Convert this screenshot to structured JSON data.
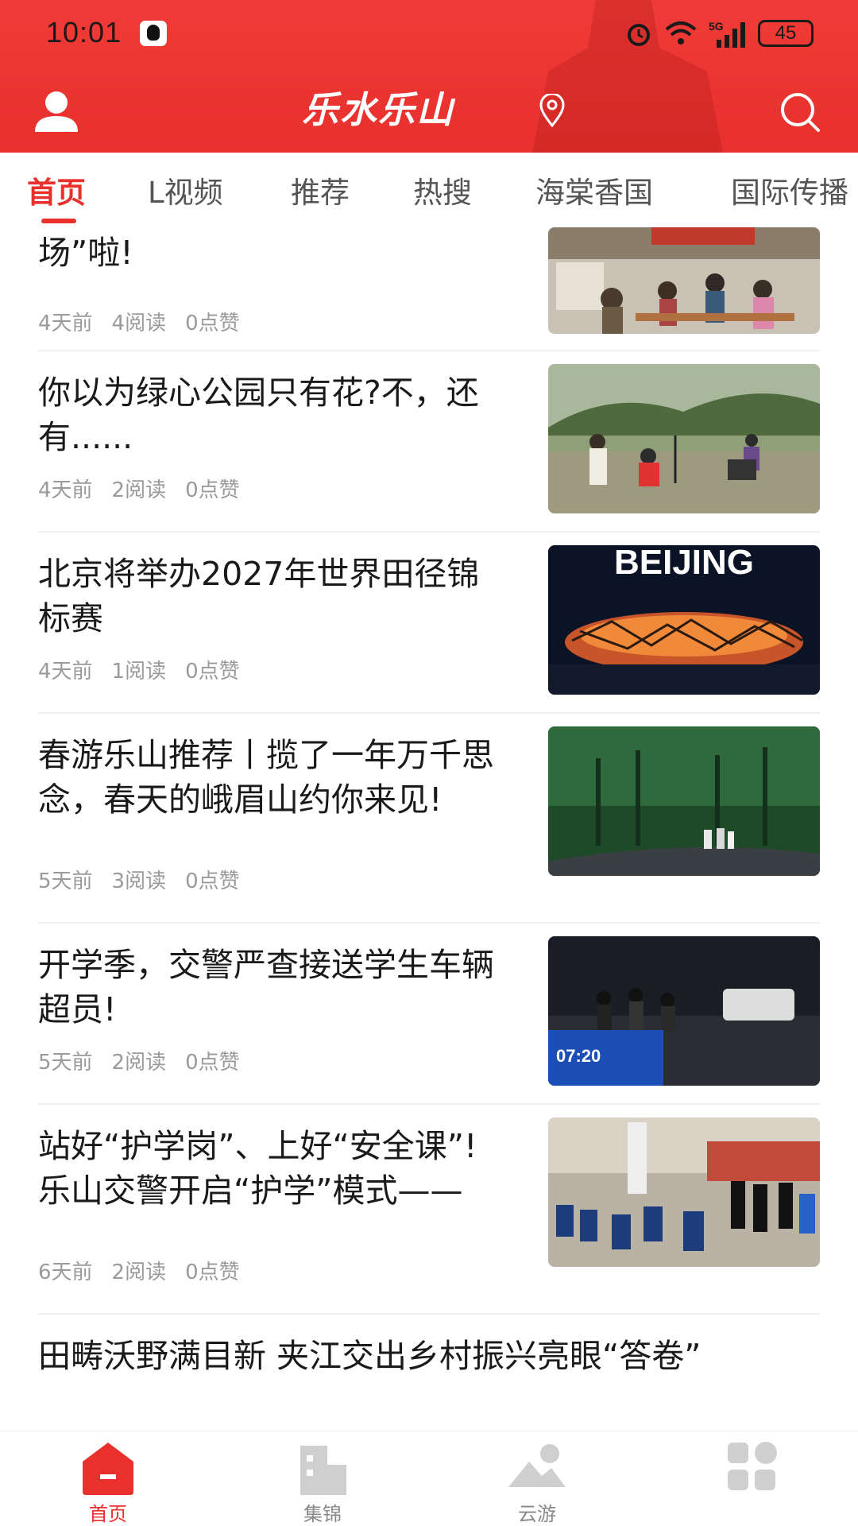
{
  "status_bar": {
    "time": "10:01",
    "network": "5G",
    "battery": "45"
  },
  "header": {
    "logo_text": "乐水乐山"
  },
  "tabs": [
    {
      "label": "首页",
      "active": true
    },
    {
      "label": "L视频"
    },
    {
      "label": "推荐"
    },
    {
      "label": "热搜"
    },
    {
      "label": "海棠香国"
    },
    {
      "label": "国际传播"
    }
  ],
  "feed": [
    {
      "title": "场”啦!",
      "time": "4天前",
      "reads": "4阅读",
      "likes": "0点赞",
      "thumb": "village-gathering"
    },
    {
      "title": "你以为绿心公园只有花?不，还有......",
      "time": "4天前",
      "reads": "2阅读",
      "likes": "0点赞",
      "thumb": "park-filming"
    },
    {
      "title": "北京将举办2027年世界田径锦标赛",
      "time": "4天前",
      "reads": "1阅读",
      "likes": "0点赞",
      "thumb": "beijing-stadium",
      "thumb_text": "BEIJING"
    },
    {
      "title": "春游乐山推荐丨揽了一年万千思念，春天的峨眉山约你来见!",
      "time": "5天前",
      "reads": "3阅读",
      "likes": "0点赞",
      "thumb": "forest-road"
    },
    {
      "title": "开学季，交警严查接送学生车辆超员!",
      "time": "5天前",
      "reads": "2阅读",
      "likes": "0点赞",
      "thumb": "night-checkpoint",
      "thumb_text": "07:20"
    },
    {
      "title": "站好“护学岗”、上好“安全课”! 乐山交警开启“护学”模式——",
      "time": "6天前",
      "reads": "2阅读",
      "likes": "0点赞",
      "thumb": "school-police"
    },
    {
      "title": "田畴沃野满目新 夹江交出乡村振兴亮眼“答卷”"
    }
  ],
  "bottom_nav": [
    {
      "label": "首页",
      "icon": "home-icon",
      "active": true
    },
    {
      "label": "集锦",
      "icon": "building-icon"
    },
    {
      "label": "云游",
      "icon": "mountain-icon"
    },
    {
      "label": "",
      "icon": "apps-icon"
    }
  ],
  "colors": {
    "brand": "#e8302d",
    "meta": "#9a9a9a"
  }
}
